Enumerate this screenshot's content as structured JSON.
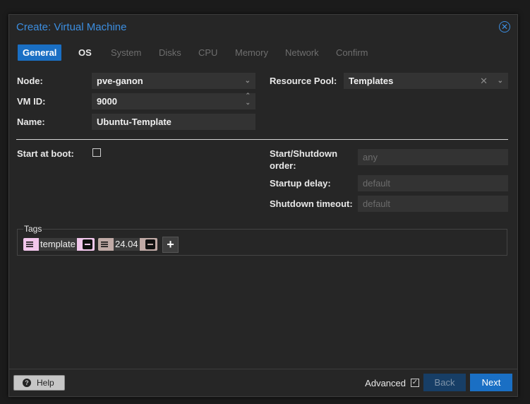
{
  "dialog": {
    "title": "Create: Virtual Machine"
  },
  "tabs": [
    {
      "label": "General"
    },
    {
      "label": "OS"
    },
    {
      "label": "System"
    },
    {
      "label": "Disks"
    },
    {
      "label": "CPU"
    },
    {
      "label": "Memory"
    },
    {
      "label": "Network"
    },
    {
      "label": "Confirm"
    }
  ],
  "form": {
    "node_label": "Node:",
    "node_value": "pve-ganon",
    "vmid_label": "VM ID:",
    "vmid_value": "9000",
    "name_label": "Name:",
    "name_value": "Ubuntu-Template",
    "pool_label": "Resource Pool:",
    "pool_value": "Templates",
    "start_boot_label": "Start at boot:",
    "order_label_1": "Start/Shutdown",
    "order_label_2": "order:",
    "order_placeholder": "any",
    "startup_delay_label": "Startup delay:",
    "startup_delay_placeholder": "default",
    "shutdown_timeout_label": "Shutdown timeout:",
    "shutdown_timeout_placeholder": "default"
  },
  "tags": {
    "legend": "Tags",
    "items": [
      {
        "text": "template",
        "color": "#f2c7ec"
      },
      {
        "text": "24.04",
        "color": "#c0aaa6"
      }
    ]
  },
  "footer": {
    "help_label": "Help",
    "advanced_label": "Advanced",
    "back_label": "Back",
    "next_label": "Next"
  },
  "colors": {
    "accent": "#1a6fc4",
    "title": "#3c8ee0",
    "background": "#262626"
  },
  "icons": [
    "close-icon",
    "chevron-down-icon",
    "spinner-icon",
    "clear-icon",
    "drag-handle-icon",
    "minus-icon",
    "plus-icon",
    "help-icon",
    "check-icon"
  ]
}
